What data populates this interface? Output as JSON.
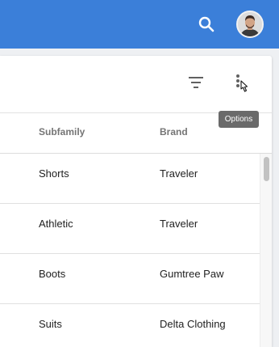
{
  "header": {
    "search_icon": "search-icon",
    "avatar_icon": "user-avatar",
    "accent": "#3b7fd9"
  },
  "toolbar": {
    "filter_icon": "filter-icon",
    "options_icon": "options-icon",
    "options_tooltip": "Options"
  },
  "table": {
    "columns": [
      "Subfamily",
      "Brand"
    ],
    "rows": [
      {
        "subfamily": "Shorts",
        "brand": "Traveler"
      },
      {
        "subfamily": "Athletic",
        "brand": "Traveler"
      },
      {
        "subfamily": "Boots",
        "brand": "Gumtree Paw"
      },
      {
        "subfamily": "Suits",
        "brand": "Delta Clothing"
      }
    ]
  }
}
